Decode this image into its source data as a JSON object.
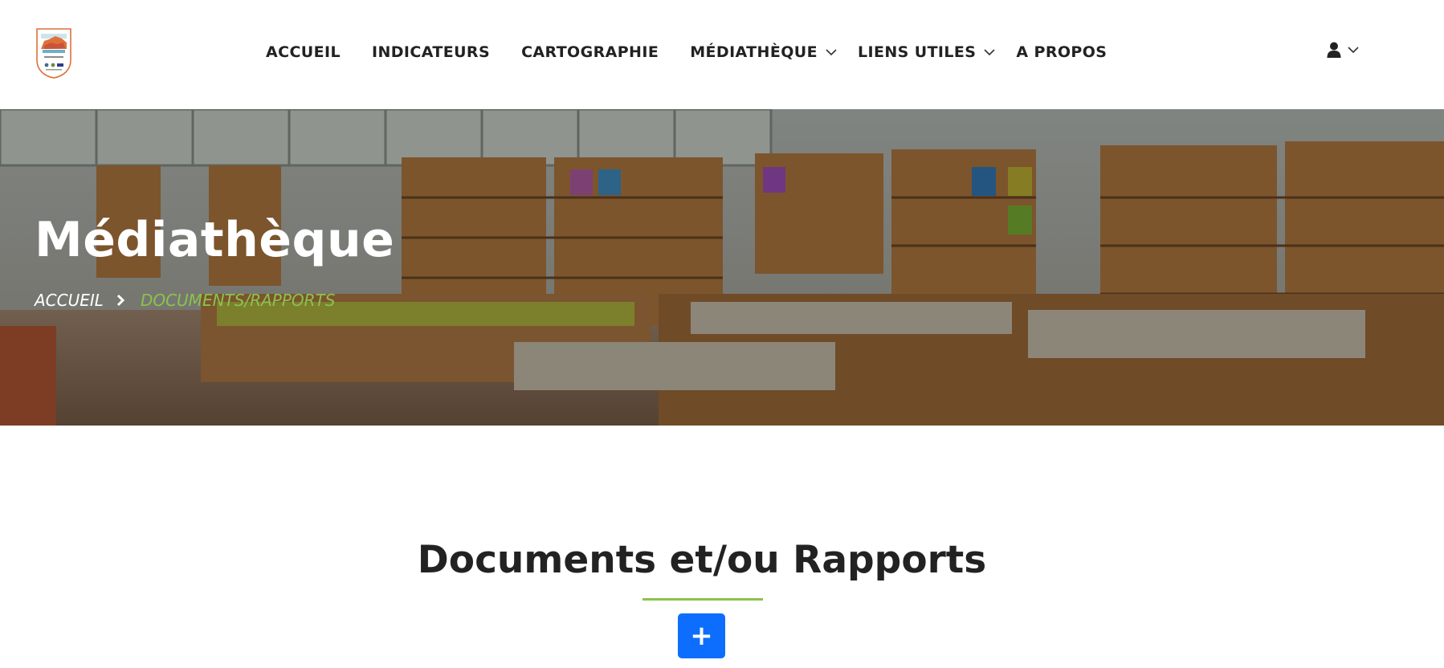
{
  "header": {
    "logo_icon": "municipal-emblem-icon",
    "nav": [
      {
        "label": "ACCUEIL",
        "dropdown": false
      },
      {
        "label": "INDICATEURS",
        "dropdown": false
      },
      {
        "label": "CARTOGRAPHIE",
        "dropdown": false
      },
      {
        "label": "MÉDIATHÈQUE",
        "dropdown": true
      },
      {
        "label": "LIENS UTILES",
        "dropdown": true
      },
      {
        "label": "A PROPOS",
        "dropdown": false
      }
    ],
    "user_icon": "user-icon",
    "chevron_icon": "chevron-down-icon"
  },
  "hero": {
    "title": "Médiathèque",
    "breadcrumb": {
      "home": "ACCUEIL",
      "separator_icon": "chevron-right-icon",
      "current": "DOCUMENTS/RAPPORTS"
    }
  },
  "section": {
    "title": "Documents et/ou Rapports",
    "add_button": {
      "label": "+",
      "icon": "plus-icon"
    }
  },
  "colors": {
    "accent_green": "#8bc34a",
    "button_blue": "#0d6efd",
    "text_dark": "#222222",
    "logo_orange": "#e0703a"
  }
}
